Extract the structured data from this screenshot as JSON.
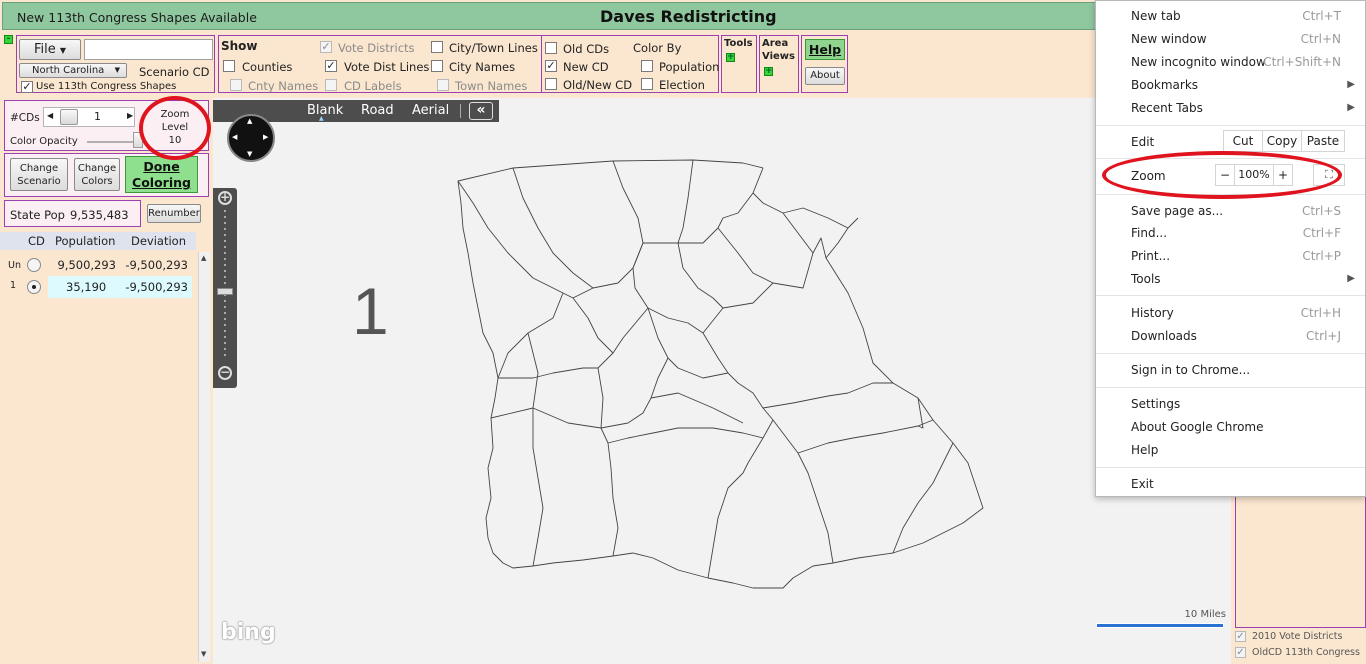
{
  "titlebar": {
    "notice": "New 113th Congress Shapes Available",
    "app_title": "Daves Redistricting"
  },
  "toolbar": {
    "collapse": "-",
    "file_label": "File",
    "state_select": "North Carolina",
    "scenario_label": "Scenario CD",
    "use_113": "Use 113th Congress Shapes",
    "show_title": "Show",
    "show": {
      "vote_districts": "Vote Districts",
      "counties": "Counties",
      "cnty_names": "Cnty Names",
      "vote_dist_lines": "Vote Dist Lines",
      "cd_labels": "CD Labels",
      "city_town_lines": "City/Town Lines",
      "city_names": "City Names",
      "town_names": "Town Names",
      "old_cds": "Old CDs",
      "new_cd": "New CD",
      "old_new_cd": "Old/New CD"
    },
    "color_by": "Color By",
    "population": "Population",
    "election": "Election",
    "tools": "Tools",
    "area": "Area",
    "views": "Views",
    "help": "Help",
    "about": "About",
    "plus": "+"
  },
  "left": {
    "num_cds_label": "#CDs",
    "num_cds_value": "1",
    "color_opacity": "Color Opacity",
    "zoom_label_1": "Zoom",
    "zoom_label_2": "Level",
    "zoom_value": "10",
    "change_scenario_1": "Change",
    "change_scenario_2": "Scenario",
    "change_colors_1": "Change",
    "change_colors_2": "Colors",
    "done_1": "Done",
    "done_2": "Coloring",
    "state_pop_label": "State Pop",
    "state_pop_value": "9,535,483",
    "renumber": "Renumber",
    "col_cd": "CD",
    "col_population": "Population",
    "col_deviation": "Deviation",
    "rows": [
      {
        "cd": "Un",
        "population": "9,500,293",
        "deviation": "-9,500,293"
      },
      {
        "cd": "1",
        "population": "35,190",
        "deviation": "-9,500,293"
      }
    ]
  },
  "map": {
    "tabs": [
      "Blank",
      "Road",
      "Aerial"
    ],
    "collapse": "«",
    "district_label": "1",
    "scale": "10 Miles",
    "logo": "bing"
  },
  "right": {
    "vote_districts_2010": "2010 Vote Districts",
    "oldcd_113": "OldCD 113th Congress"
  },
  "chrome_menu": {
    "new_tab": "New tab",
    "new_tab_sc": "Ctrl+T",
    "new_window": "New window",
    "new_window_sc": "Ctrl+N",
    "incognito": "New incognito window",
    "incognito_sc": "Ctrl+Shift+N",
    "bookmarks": "Bookmarks",
    "recent_tabs": "Recent Tabs",
    "edit": "Edit",
    "cut": "Cut",
    "copy": "Copy",
    "paste": "Paste",
    "zoom": "Zoom",
    "zoom_minus": "−",
    "zoom_value": "100%",
    "zoom_plus": "+",
    "save_page": "Save page as...",
    "save_page_sc": "Ctrl+S",
    "find": "Find...",
    "find_sc": "Ctrl+F",
    "print": "Print...",
    "print_sc": "Ctrl+P",
    "tools": "Tools",
    "history": "History",
    "history_sc": "Ctrl+H",
    "downloads": "Downloads",
    "downloads_sc": "Ctrl+J",
    "sign_in": "Sign in to Chrome...",
    "settings": "Settings",
    "about_chrome": "About Google Chrome",
    "help": "Help",
    "exit": "Exit"
  },
  "annotation_color": "#e0141e"
}
